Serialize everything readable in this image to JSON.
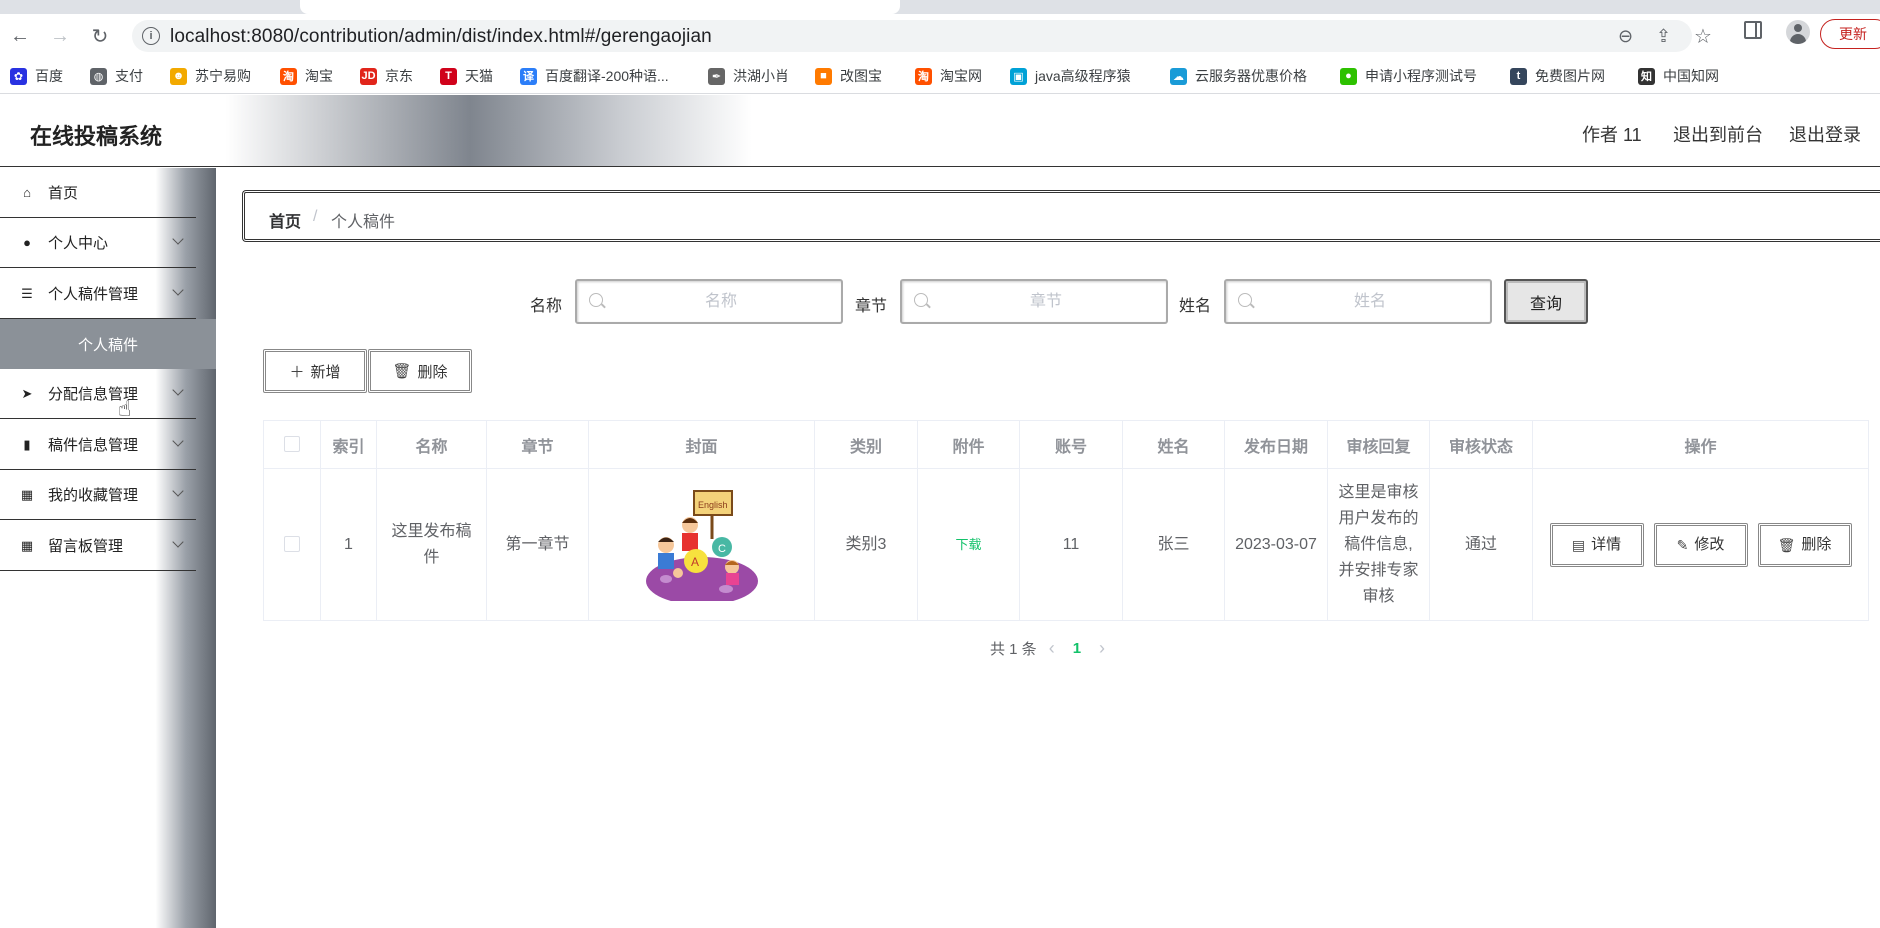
{
  "browser": {
    "url": "localhost:8080/contribution/admin/dist/index.html#/gerengaojian",
    "update_label": "更新",
    "bookmarks": [
      {
        "label": "百度",
        "icon": "baidu-paw-icon",
        "color": "#2932e1"
      },
      {
        "label": "支付",
        "icon": "globe-icon",
        "color": "#5f6368"
      },
      {
        "label": "苏宁易购",
        "icon": "suning-lion-icon",
        "color": "#f2a900"
      },
      {
        "label": "淘宝",
        "icon": "taobao-icon",
        "color": "#ff5000"
      },
      {
        "label": "京东",
        "icon": "jd-icon",
        "color": "#e1251b"
      },
      {
        "label": "天猫",
        "icon": "tmall-icon",
        "color": "#d0021b"
      },
      {
        "label": "百度翻译-200种语...",
        "icon": "baidu-translate-icon",
        "color": "#2c7ef8"
      },
      {
        "label": "洪湖小肖",
        "icon": "feather-icon",
        "color": "#666666"
      },
      {
        "label": "改图宝",
        "icon": "gaitubao-icon",
        "color": "#ff7a00"
      },
      {
        "label": "淘宝网",
        "icon": "taobao-icon",
        "color": "#ff5000"
      },
      {
        "label": "java高级程序猿",
        "icon": "bilibili-icon",
        "color": "#00a1d6"
      },
      {
        "label": "云服务器优惠价格",
        "icon": "cloud-icon",
        "color": "#1a9bd7"
      },
      {
        "label": "申请小程序测试号",
        "icon": "wechat-icon",
        "color": "#2dc100"
      },
      {
        "label": "免费图片网",
        "icon": "tumblr-icon",
        "color": "#35465c"
      },
      {
        "label": "中国知网",
        "icon": "cnki-icon",
        "color": "#333333"
      }
    ]
  },
  "header": {
    "title": "在线投稿系统",
    "user": "作者 11",
    "to_front": "退出到前台",
    "logout": "退出登录"
  },
  "sidebar": {
    "items": [
      {
        "label": "首页",
        "icon": "home-icon",
        "has_children": false
      },
      {
        "label": "个人中心",
        "icon": "user-icon",
        "has_children": true
      },
      {
        "label": "个人稿件管理",
        "icon": "list-icon",
        "has_children": true
      },
      {
        "label": "分配信息管理",
        "icon": "send-icon",
        "has_children": true
      },
      {
        "label": "稿件信息管理",
        "icon": "chart-icon",
        "has_children": true
      },
      {
        "label": "我的收藏管理",
        "icon": "grid-icon",
        "has_children": true
      },
      {
        "label": "留言板管理",
        "icon": "grid-icon",
        "has_children": true
      }
    ],
    "active_sub": "个人稿件"
  },
  "breadcrumb": {
    "home": "首页",
    "separator": "/",
    "current": "个人稿件"
  },
  "search": {
    "name_label": "名称",
    "name_placeholder": "名称",
    "chapter_label": "章节",
    "chapter_placeholder": "章节",
    "person_label": "姓名",
    "person_placeholder": "姓名",
    "query_label": "查询"
  },
  "actions": {
    "add_label": "新增",
    "delete_label": "删除"
  },
  "table": {
    "headers": [
      "索引",
      "名称",
      "章节",
      "封面",
      "类别",
      "附件",
      "账号",
      "姓名",
      "发布日期",
      "审核回复",
      "审核状态",
      "操作"
    ],
    "rows": [
      {
        "index": "1",
        "name": "这里发布稿件",
        "chapter": "第一章节",
        "cover_text": "English",
        "category": "类别3",
        "attachment": "下载",
        "account": "11",
        "person": "张三",
        "date": "2023-03-07",
        "review_reply": "这里是审核用户发布的稿件信息,并安排专家审核",
        "review_status": "通过",
        "detail_label": "详情",
        "edit_label": "修改",
        "delete_label": "删除"
      }
    ]
  },
  "pagination": {
    "total_text": "共 1 条",
    "current_page": "1"
  }
}
